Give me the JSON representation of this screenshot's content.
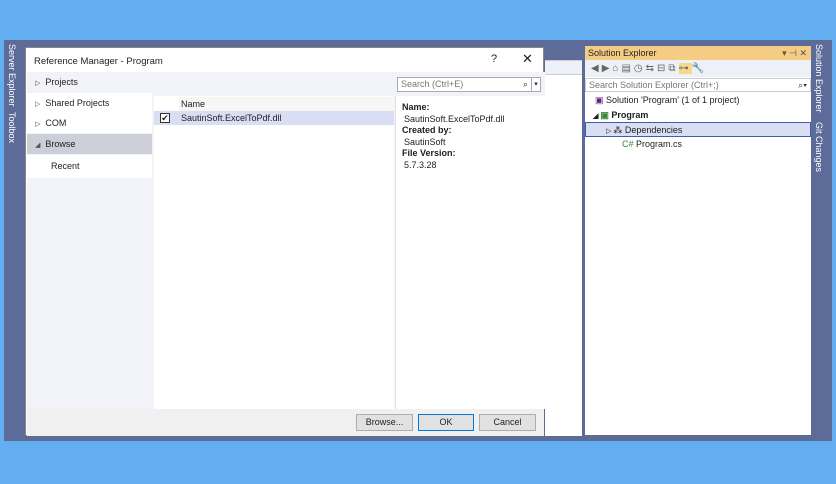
{
  "side_tabs": {
    "server_explorer": "Server Explorer",
    "toolbox": "Toolbox",
    "solution_explorer": "Solution Explorer",
    "git_changes": "Git Changes"
  },
  "dialog": {
    "title": "Reference Manager - Program",
    "help": "?",
    "close": "✕",
    "nav": [
      {
        "label": "Projects"
      },
      {
        "label": "Shared Projects"
      },
      {
        "label": "COM"
      },
      {
        "label": "Browse"
      },
      {
        "label": "Recent"
      }
    ],
    "search_placeholder": "Search (Ctrl+E)",
    "column_header": "Name",
    "rows": [
      {
        "name": "SautinSoft.ExcelToPdf.dll",
        "checked": true
      }
    ],
    "details": {
      "name_label": "Name:",
      "name": "SautinSoft.ExcelToPdf.dll",
      "created_label": "Created by:",
      "created": "SautinSoft",
      "version_label": "File Version:",
      "version": "5.7.3.28"
    },
    "buttons": {
      "browse": "Browse...",
      "ok": "OK",
      "cancel": "Cancel"
    }
  },
  "solution_explorer": {
    "title": "Solution Explorer",
    "controls": "▾ ⊣ ✕",
    "search_placeholder": "Search Solution Explorer (Ctrl+;)",
    "tree": {
      "solution": "Solution 'Program' (1 of 1 project)",
      "project": "Program",
      "dependencies": "Dependencies",
      "file": "Program.cs"
    }
  }
}
